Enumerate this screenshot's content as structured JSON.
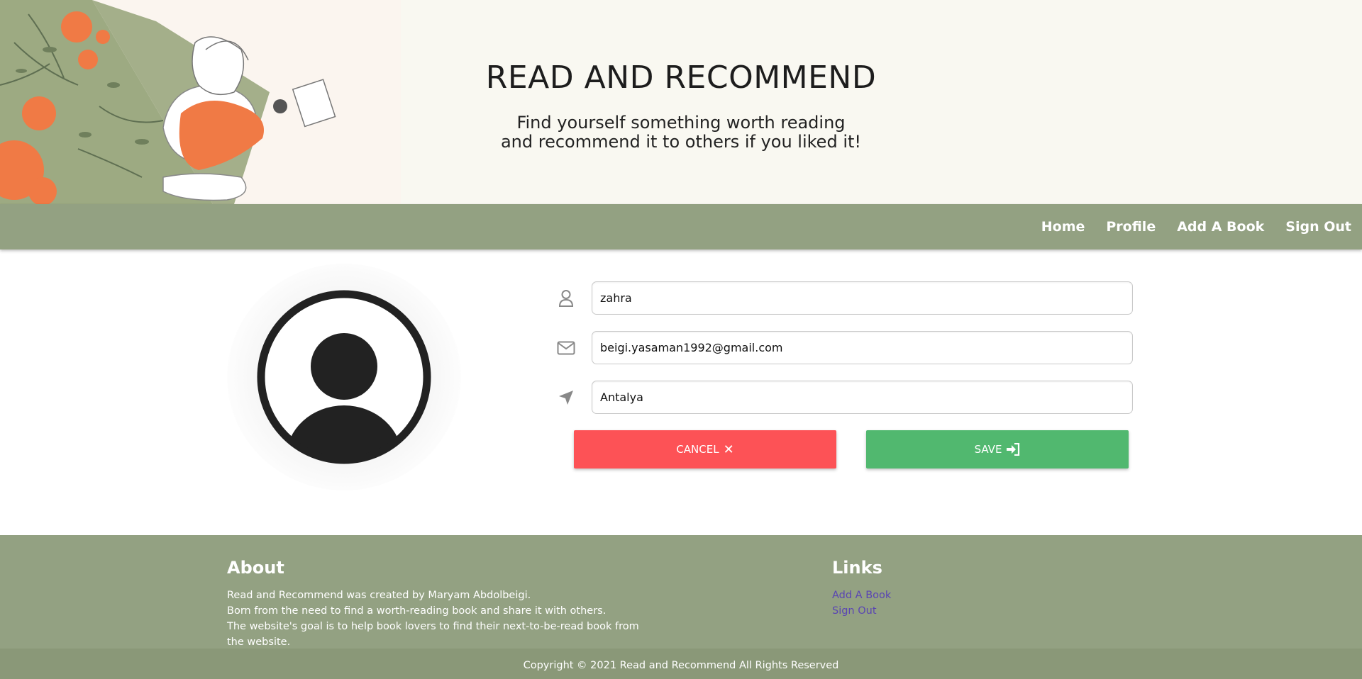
{
  "hero": {
    "title": "READ AND RECOMMEND",
    "subtitle_line1": "Find yourself something worth reading",
    "subtitle_line2": "and recommend it to others if you liked it!"
  },
  "nav": {
    "items": [
      {
        "label": "Home"
      },
      {
        "label": "Profile"
      },
      {
        "label": "Add A Book"
      },
      {
        "label": "Sign Out"
      }
    ]
  },
  "profile": {
    "avatar_icon": "user-avatar-icon",
    "fields": [
      {
        "icon": "user-icon",
        "value": "zahra"
      },
      {
        "icon": "envelope-icon",
        "value": "beigi.yasaman1992@gmail.com"
      },
      {
        "icon": "location-arrow-icon",
        "value": "Antalya"
      }
    ],
    "cancel_label": "CANCEL",
    "cancel_icon": "✕",
    "save_label": "SAVE",
    "save_icon": "sign-in-icon"
  },
  "footer": {
    "about_title": "About",
    "about_lines": [
      "Read and Recommend was created by Maryam Abdolbeigi.",
      "Born from the need to find a worth-reading book and share it with others.",
      "The website's goal is to help book lovers to find their next-to-be-read book from the website."
    ],
    "links_title": "Links",
    "links": [
      {
        "label": "Add A Book"
      },
      {
        "label": "Sign Out"
      }
    ],
    "copyright": "Copyright © 2021 Read and Recommend All Rights Reserved"
  },
  "colors": {
    "nav_bg": "#93a182",
    "hero_bg": "#f9f8f1",
    "cancel": "#fd5256",
    "save": "#51b86f",
    "link": "#5a45b3"
  }
}
